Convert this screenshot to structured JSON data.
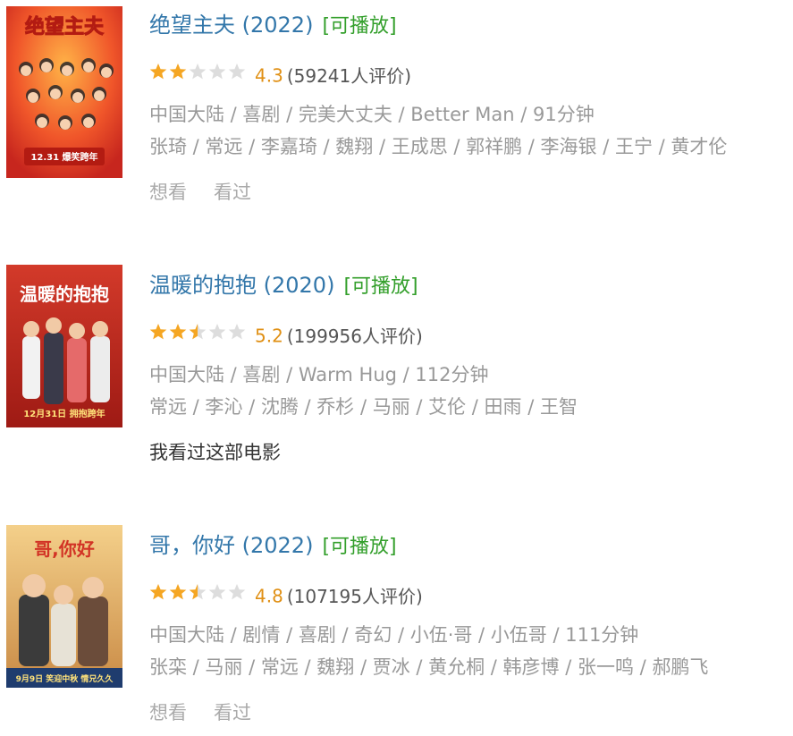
{
  "movies": [
    {
      "title": "绝望主夫 (2022)",
      "playable": "[可播放]",
      "rating": 4.3,
      "stars": 2,
      "score": "4.3",
      "votes": "(59241人评价)",
      "info": "中国大陆 / 喜剧 / 完美大丈夫 / Better Man / 91分钟",
      "cast": "张琦 / 常远 / 李嘉琦 / 魏翔 / 王成思 / 郭祥鹏 / 李海银 / 王宁 / 黄才伦",
      "want_label": "想看",
      "seen_label": "看过",
      "poster_title": "绝望主夫",
      "poster_date": "12.31 爆笑跨年",
      "poster_color": "#e8452a"
    },
    {
      "title": "温暖的抱抱 (2020)",
      "playable": "[可播放]",
      "rating": 5.2,
      "stars": 2.5,
      "score": "5.2",
      "votes": "(199956人评价)",
      "info": "中国大陆 / 喜剧 / Warm Hug / 112分钟",
      "cast": "常远 / 李沁 / 沈腾 / 乔杉 / 马丽 / 艾伦 / 田雨 / 王智",
      "status": "我看过这部电影",
      "poster_title": "温暖的抱抱",
      "poster_date": "12月31日 拥抱跨年",
      "poster_color": "#c4271f"
    },
    {
      "title": "哥，你好 (2022)",
      "playable": "[可播放]",
      "rating": 4.8,
      "stars": 2.5,
      "score": "4.8",
      "votes": "(107195人评价)",
      "info": "中国大陆 / 剧情 / 喜剧 / 奇幻 / 小伍·哥 / 小伍哥 / 111分钟",
      "cast": "张栾 / 马丽 / 常远 / 魏翔 / 贾冰 / 黄允桐 / 韩彦博 / 张一鸣 / 郝鹏飞",
      "want_label": "想看",
      "seen_label": "看过",
      "poster_title": "哥,你好",
      "poster_date": "9月9日 笑迎中秋 情兄久久",
      "poster_color": "#e9b86a"
    }
  ],
  "colors": {
    "link": "#3377aa",
    "playable": "#339f2b",
    "score": "#e09015",
    "meta": "#999999",
    "star_on": "#f5a623",
    "star_off": "#dddddd"
  }
}
